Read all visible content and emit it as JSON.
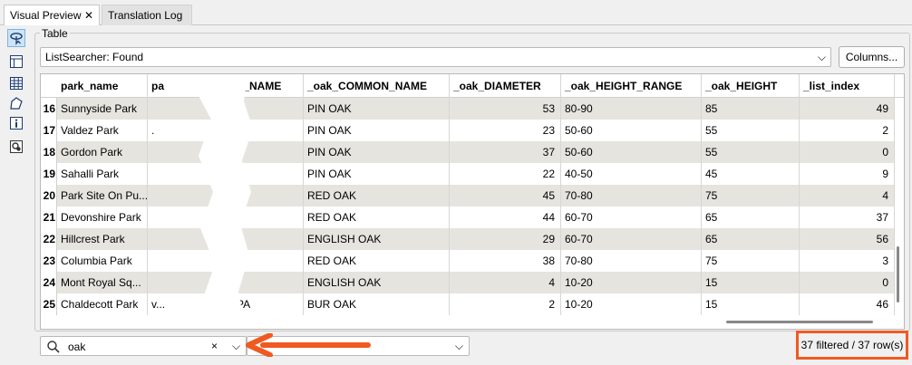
{
  "tabs": [
    {
      "label": "Visual Preview",
      "close": "✕"
    },
    {
      "label": "Translation Log"
    }
  ],
  "rail": {
    "icons": [
      "inspect-pointer-icon",
      "layout-panel-icon",
      "table-view-icon",
      "feature-info-icon",
      "information-icon",
      "coordinate-system-icon"
    ]
  },
  "group_title": "Table",
  "dataset_combo": {
    "value": "ListSearcher: Found",
    "chevron": "⌵"
  },
  "columns_button": "Columns...",
  "table": {
    "headers": [
      "park_name",
      "pa",
      "IES_NAME",
      "_oak_COMMON_NAME",
      "_oak_DIAMETER",
      "_oak_HEIGHT_RANGE",
      "_oak_HEIGHT",
      "_list_index"
    ],
    "rows": [
      {
        "n": "16",
        "park": "Sunnyside Park",
        "c2": "",
        "ies": "",
        "common": "PIN OAK",
        "diam": "53",
        "range": "80-90",
        "height": "85",
        "idx": "49"
      },
      {
        "n": "17",
        "park": "Valdez Park",
        "c2": ".",
        "ies": "",
        "common": "PIN OAK",
        "diam": "23",
        "range": "50-60",
        "height": "55",
        "idx": "2"
      },
      {
        "n": "18",
        "park": "Gordon Park",
        "c2": "",
        "ies": "",
        "common": "PIN OAK",
        "diam": "37",
        "range": "50-60",
        "height": "55",
        "idx": "0"
      },
      {
        "n": "19",
        "park": "Sahalli Park",
        "c2": "",
        "ies": "",
        "common": "PIN OAK",
        "diam": "22",
        "range": "40-50",
        "height": "45",
        "idx": "9"
      },
      {
        "n": "20",
        "park": "Park Site On Pu...",
        "c2": "",
        "ies": "",
        "common": "RED OAK",
        "diam": "45",
        "range": "70-80",
        "height": "75",
        "idx": "4"
      },
      {
        "n": "21",
        "park": "Devonshire Park",
        "c2": "",
        "ies": "",
        "common": "RED OAK",
        "diam": "44",
        "range": "60-70",
        "height": "65",
        "idx": "37"
      },
      {
        "n": "22",
        "park": "Hillcrest Park",
        "c2": "",
        "ies": "",
        "common": "ENGLISH OAK",
        "diam": "29",
        "range": "60-70",
        "height": "65",
        "idx": "56"
      },
      {
        "n": "23",
        "park": "Columbia Park",
        "c2": "",
        "ies": "",
        "common": "RED OAK",
        "diam": "38",
        "range": "70-80",
        "height": "75",
        "idx": "3"
      },
      {
        "n": "24",
        "park": "Mont Royal Sq...",
        "c2": "",
        "ies": "",
        "common": "ENGLISH OAK",
        "diam": "4",
        "range": "10-20",
        "height": "15",
        "idx": "0"
      },
      {
        "n": "25",
        "park": "Chaldecott Park",
        "c2": "v...",
        "ies": ".RPA",
        "common": "BUR OAK",
        "diam": "2",
        "range": "10-20",
        "height": "15",
        "idx": "46"
      }
    ]
  },
  "search": {
    "value": "oak",
    "clear": "×",
    "dropdown": "⌵"
  },
  "filter_combo": {
    "value": "",
    "chevron": "⌵"
  },
  "status": "37 filtered / 37 row(s)",
  "colors": {
    "highlight": "#ef5a21",
    "alt_row": "#e6e4df",
    "selection": "#cce4f7"
  }
}
